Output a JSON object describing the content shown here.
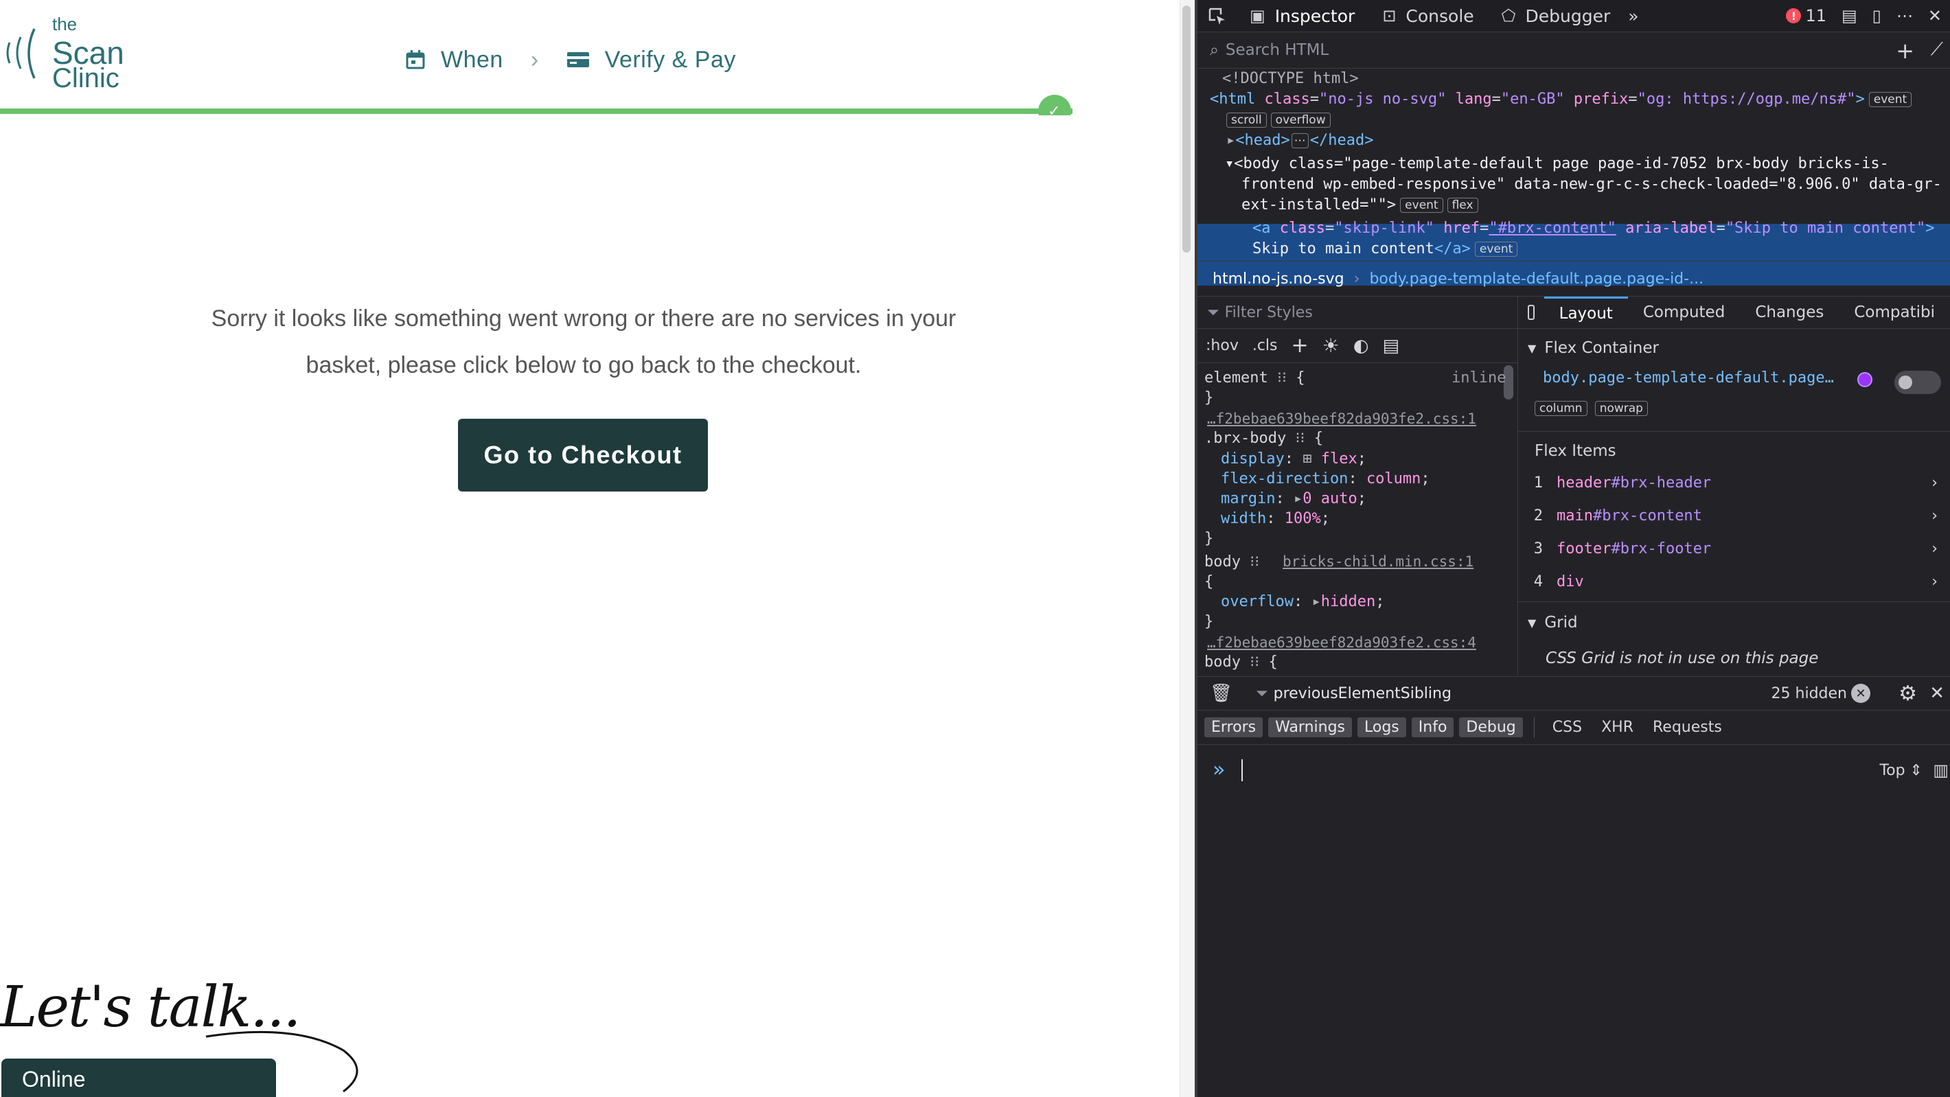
{
  "site": {
    "logo": {
      "line1": "the",
      "line2": "Scan",
      "line3": "Clinic"
    },
    "steps": [
      {
        "label": "When",
        "icon": "calendar-icon"
      },
      {
        "label": "Verify & Pay",
        "icon": "credit-card-icon"
      }
    ],
    "progress_fraction": 1.0,
    "message_line1": "Sorry it looks like something went wrong or there are no services in your",
    "message_line2": "basket, please click below to go back to the checkout.",
    "checkout_button": "Go to Checkout",
    "lets_talk": "Let's talk...",
    "online_button": "Online",
    "colors": {
      "brand_teal": "#2e7077",
      "button_dark": "#1f3b3c",
      "progress_green": "#6ac26a"
    }
  },
  "devtools": {
    "tabs": [
      {
        "label": "Inspector",
        "icon": "inspector-icon"
      },
      {
        "label": "Console",
        "icon": "console-icon"
      },
      {
        "label": "Debugger",
        "icon": "debugger-icon"
      }
    ],
    "error_count": "11",
    "search_placeholder": "Search HTML",
    "tree": {
      "doctype": "<!DOCTYPE html>",
      "html_open": "<html",
      "html_attr1": "class",
      "html_val1": "\"no-js no-svg\"",
      "html_attr2": "lang",
      "html_val2": "\"en-GB\"",
      "html_attr3": "prefix",
      "html_val3": "\"og: https://ogp.me/ns#\"",
      "html_close": ">",
      "badge_event": "event",
      "badge_scroll": "scroll",
      "badge_overflow": "overflow",
      "head": "<head>",
      "head_close": "</head>",
      "body_line1": "<body class=\"page-template-default page page-id-7052 brx-body bricks-is-",
      "body_line2": "frontend wp-embed-responsive\" data-new-gr-c-s-check-loaded=\"8.906.0\" data-gr-",
      "body_line3": "ext-installed=\"\">",
      "badge_flex": "flex",
      "a_open": "<a",
      "a_attr1": "class",
      "a_val1": "\"skip-link\"",
      "a_attr2": "href",
      "a_val2": "\"#brx-content\"",
      "a_attr3": "aria-label",
      "a_val3": "\"Skip to main content\"",
      "a_close": ">",
      "a_text": "Skip to main content",
      "a_end": "</a>"
    },
    "breadcrumbs": [
      "html.no-js.no-svg",
      "body.page-template-default.page.page-id-..."
    ],
    "rules": {
      "filter_placeholder": "Filter Styles",
      "hov": ":hov",
      "cls": ".cls",
      "element_sel": "element",
      "element_src": "inline",
      "src1": "…f2bebae639beef82da903fe2.css:1",
      "sel1": ".brx-body",
      "decl": [
        {
          "p": "display",
          "v": "flex"
        },
        {
          "p": "flex-direction",
          "v": "column"
        },
        {
          "p": "margin",
          "v": "0 auto"
        },
        {
          "p": "width",
          "v": "100%"
        }
      ],
      "sel2": "body",
      "src2": "bricks-child.min.css:1",
      "decl2_p": "overflow",
      "decl2_v": "hidden",
      "src3": "…f2bebae639beef82da903fe2.css:4",
      "sel3": "body"
    },
    "layout": {
      "tabs": [
        "Layout",
        "Computed",
        "Changes",
        "Compatibi"
      ],
      "flex_container_title": "Flex Container",
      "flex_container_selector": "body.page-template-default.page…",
      "badge_column": "column",
      "badge_nowrap": "nowrap",
      "flex_items_title": "Flex Items",
      "flex_items": [
        {
          "n": "1",
          "tag": "header",
          "id": "#brx-header"
        },
        {
          "n": "2",
          "tag": "main",
          "id": "#brx-content"
        },
        {
          "n": "3",
          "tag": "footer",
          "id": "#brx-footer"
        },
        {
          "n": "4",
          "tag": "div",
          "id": ""
        }
      ],
      "grid_title": "Grid",
      "grid_message": "CSS Grid is not in use on this page"
    },
    "console": {
      "filter_value": "previousElementSibling",
      "hidden_count": "25 hidden",
      "filters": [
        "Errors",
        "Warnings",
        "Logs",
        "Info",
        "Debug"
      ],
      "extra_filters": [
        "CSS",
        "XHR",
        "Requests"
      ],
      "context": "Top"
    }
  }
}
